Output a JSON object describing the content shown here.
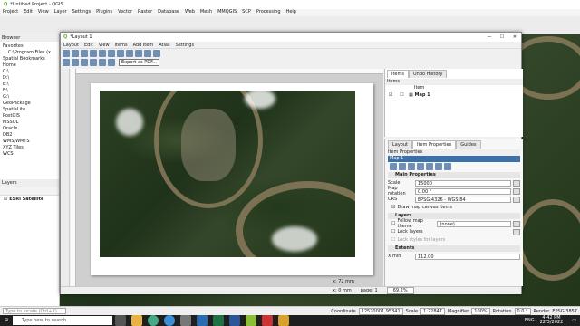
{
  "qgis": {
    "title": "*Untitled Project - QGIS",
    "menu": [
      "Project",
      "Edit",
      "View",
      "Layer",
      "Settings",
      "Plugins",
      "Vector",
      "Raster",
      "Database",
      "Web",
      "Mesh",
      "MMQGIS",
      "SCP",
      "Processing",
      "Help"
    ],
    "browser": {
      "header": "Browser",
      "items": [
        {
          "label": "Favorites"
        },
        {
          "label": "C:\\Program Files (x",
          "indent": true
        },
        {
          "label": "Spatial Bookmarks"
        },
        {
          "label": "Home"
        },
        {
          "label": "C:\\"
        },
        {
          "label": "D:\\"
        },
        {
          "label": "E:\\"
        },
        {
          "label": "F:\\"
        },
        {
          "label": "G:\\"
        },
        {
          "label": "GeoPackage"
        },
        {
          "label": "SpatiaLite"
        },
        {
          "label": "PostGIS"
        },
        {
          "label": "MSSQL"
        },
        {
          "label": "Oracle"
        },
        {
          "label": "DB2"
        },
        {
          "label": "WMS/WMTS"
        },
        {
          "label": "XYZ Tiles"
        },
        {
          "label": "WCS"
        }
      ]
    },
    "layers": {
      "header": "Layers",
      "items": [
        {
          "label": "ESRI Satellite"
        }
      ]
    },
    "locator_placeholder": "Type to locate (Ctrl+K)",
    "status": {
      "coordinate_label": "Coordinate",
      "coordinate": "12570001,95341",
      "scale_label": "Scale",
      "scale": "1:22847",
      "magnifier_label": "Magnifier",
      "magnifier": "100%",
      "rotation_label": "Rotation",
      "rotation": "0.0 °",
      "render_label": "Render",
      "crs": "EPSG:3857"
    }
  },
  "layout": {
    "title": "*Layout 1",
    "menu": [
      "Layout",
      "Edit",
      "View",
      "Items",
      "Add Item",
      "Atlas",
      "Settings"
    ],
    "tooltip": "Export as PDF...",
    "status": {
      "coords": "x: 0 mm",
      "page": "page: 1",
      "zoom": "69.2%",
      "right_coord": "x: 72 mm"
    },
    "items_panel": {
      "tabs": [
        "Items",
        "Undo History"
      ],
      "header": "Items",
      "col": "Item",
      "row": "Map 1"
    },
    "props_panel": {
      "tabs": [
        "Layout",
        "Item Properties",
        "Guides"
      ],
      "header": "Item Properties",
      "item": "Map 1",
      "main_section": "Main Properties",
      "scale_label": "Scale",
      "scale": "15000",
      "rotation_label": "Map rotation",
      "rotation": "0.00 °",
      "crs_label": "CRS",
      "crs": "EPSG:4326 - WGS 84",
      "draw_grid": "Draw map canvas items",
      "layers_section": "Layers",
      "follow_theme": "Follow map theme",
      "theme_value": "(none)",
      "lock_layers": "Lock layers",
      "lock_styles": "Lock styles for layers",
      "extents_section": "Extents",
      "xmin_label": "X min",
      "xmin": "112.00"
    }
  },
  "taskbar": {
    "search_placeholder": "Type here to search",
    "time": "4:42 PM",
    "date": "22/3/2022",
    "lang": "ENG"
  }
}
